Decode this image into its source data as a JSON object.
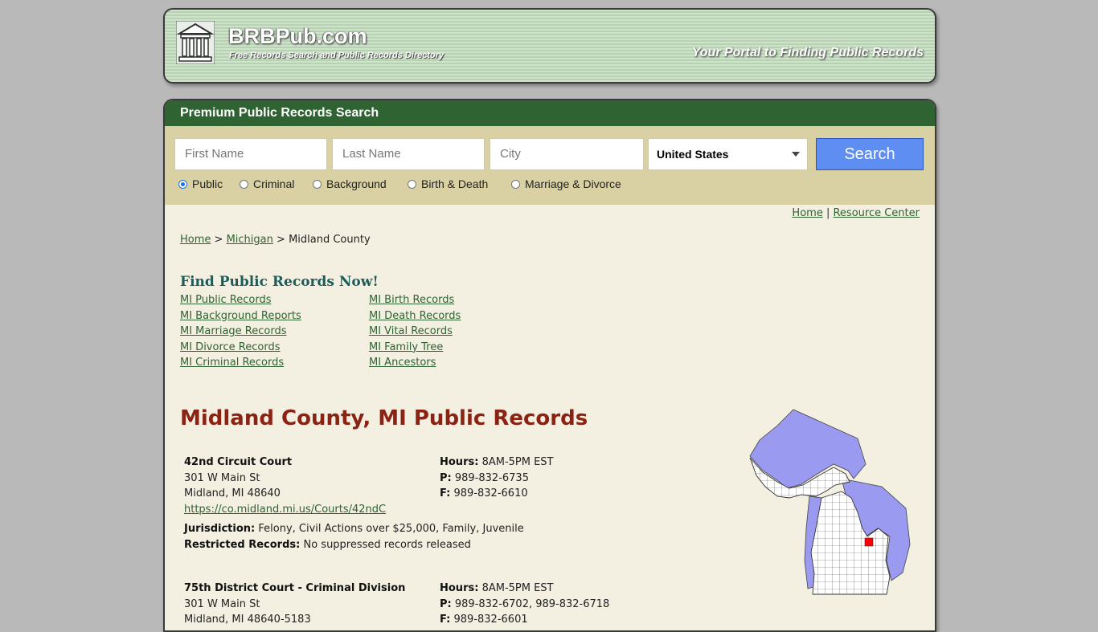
{
  "header": {
    "site_name": "BRBPub.com",
    "tagline": "Free Records Search and Public Records Directory",
    "portal_text": "Your Portal to Finding Public Records"
  },
  "search": {
    "panel_title": "Premium Public Records Search",
    "first_name_placeholder": "First Name",
    "last_name_placeholder": "Last Name",
    "city_placeholder": "City",
    "country_selected": "United States",
    "button_label": "Search",
    "radios": [
      {
        "label": "Public",
        "checked": true
      },
      {
        "label": "Criminal",
        "checked": false
      },
      {
        "label": "Background",
        "checked": false
      },
      {
        "label": "Birth & Death",
        "checked": false
      },
      {
        "label": "Marriage & Divorce",
        "checked": false
      }
    ]
  },
  "top_links": {
    "home": "Home",
    "separator": "|",
    "resource": "Resource Center"
  },
  "breadcrumb": {
    "home": "Home",
    "sep1": ">",
    "state": "Michigan",
    "sep2": ">",
    "current": "Midland County"
  },
  "find": {
    "title": "Find Public Records Now!",
    "left": [
      "MI Public Records",
      "MI Background Reports",
      "MI Marriage Records",
      "MI Divorce Records",
      "MI Criminal Records"
    ],
    "right": [
      "MI Birth Records",
      "MI Death Records",
      "MI Vital Records",
      "MI Family Tree",
      "MI Ancestors"
    ]
  },
  "county_title": "Midland County, MI Public Records",
  "offices": [
    {
      "name": "42nd Circuit Court",
      "address1": "301 W Main St",
      "address2": "Midland, MI 48640",
      "url": "https://co.midland.mi.us/Courts/42ndC",
      "hours_label": "Hours:",
      "hours": "8AM-5PM EST",
      "phone_label": "P:",
      "phone": "989-832-6735",
      "fax_label": "F:",
      "fax": "989-832-6610",
      "jurisdiction_label": "Jurisdiction:",
      "jurisdiction": "Felony, Civil Actions over $25,000, Family, Juvenile",
      "restricted_label": "Restricted Records:",
      "restricted": "No suppressed records released"
    },
    {
      "name": "75th District Court - Criminal Division",
      "address1": "301 W Main St",
      "address2": "Midland, MI 48640-5183",
      "hours_label": "Hours:",
      "hours": "8AM-5PM EST",
      "phone_label": "P:",
      "phone": "989-832-6702, 989-832-6718",
      "fax_label": "F:",
      "fax": "989-832-6601"
    }
  ],
  "map": {
    "land_color": "#ffffff",
    "water_color": "#9a9af0",
    "highlight_color": "#ff0000",
    "highlight_label": "Midland County"
  }
}
